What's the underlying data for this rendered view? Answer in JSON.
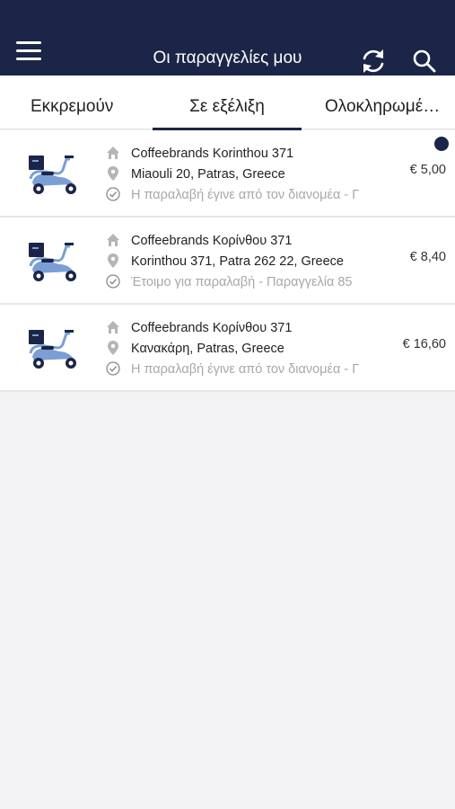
{
  "header": {
    "title": "Οι παραγγελίες μου",
    "menu_icon": "hamburger-menu-icon",
    "refresh_icon": "refresh-icon",
    "search_icon": "search-icon"
  },
  "tabs": [
    {
      "label": "Εκκρεμούν",
      "active": false
    },
    {
      "label": "Σε εξέλιξη",
      "active": true
    },
    {
      "label": "Ολοκληρωμένες",
      "active": false
    }
  ],
  "orders": [
    {
      "store": "Coffeebrands Korinthou 371",
      "address": "Miaouli 20, Patras, Greece",
      "status": "Η παραλαβή έγινε από τον διανομέα - Γ",
      "price": "€ 5,00",
      "unread": true
    },
    {
      "store": "Coffeebrands Κορίνθου 371",
      "address": "Korinthou 371, Patra 262 22, Greece",
      "status": "Έτοιμο για παραλαβή - Παραγγελία 85",
      "price": "€ 8,40",
      "unread": false
    },
    {
      "store": "Coffeebrands Κορίνθου 371",
      "address": "Κανακάρη, Patras, Greece",
      "status": "Η παραλαβή έγινε από τον διανομέα - Γ",
      "price": "€ 16,60",
      "unread": false
    }
  ],
  "colors": {
    "brand_navy": "#1b2547",
    "scooter_blue": "#7b9fd4",
    "muted_text": "#a8a8a8",
    "background": "#f3f3f5"
  }
}
